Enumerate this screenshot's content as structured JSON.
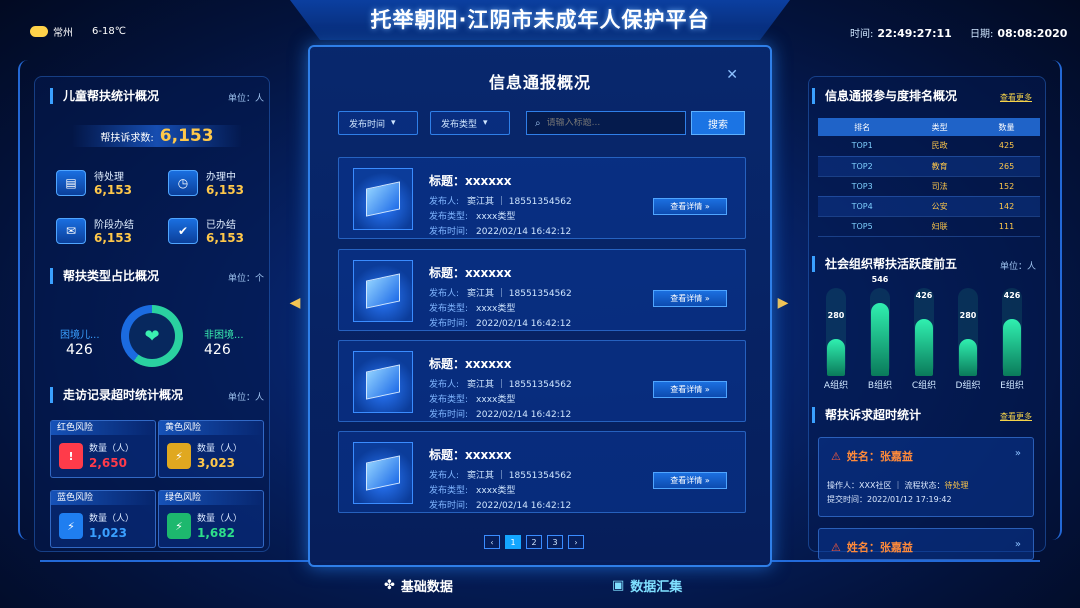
{
  "header": {
    "title": "托举朝阳·江阴市未成年人保护平台",
    "weather_city": "常州",
    "weather_temp": "6-18℃",
    "time_label": "时间:",
    "time_value": "22:49:27:11",
    "date_label": "日期:",
    "date_value": "08:08:2020"
  },
  "left": {
    "child_help": {
      "title": "儿童帮扶统计概况",
      "unit": "单位：人",
      "banner_label": "帮扶诉求数:",
      "banner_value": "6,153",
      "stats": [
        {
          "label": "待处理",
          "value": "6,153"
        },
        {
          "label": "办理中",
          "value": "6,153"
        },
        {
          "label": "阶段办结",
          "value": "6,153"
        },
        {
          "label": "已办结",
          "value": "6,153"
        }
      ]
    },
    "help_type": {
      "title": "帮扶类型占比概况",
      "unit": "单位：个",
      "left_label": "困境儿...",
      "left_value": "426",
      "right_label": "非困境...",
      "right_value": "426",
      "share_hardship": 0.6
    },
    "visit": {
      "title": "走访记录超时统计概况",
      "unit": "单位：人",
      "cards": [
        {
          "title": "红色风险",
          "count_label": "数量（人）",
          "value": "2,650",
          "color": "#ff3b4a"
        },
        {
          "title": "黄色风险",
          "count_label": "数量（人）",
          "value": "3,023",
          "color": "#ffc84a"
        },
        {
          "title": "蓝色风险",
          "count_label": "数量（人）",
          "value": "1,023",
          "color": "#3aa0ff"
        },
        {
          "title": "绿色风险",
          "count_label": "数量（人）",
          "value": "1,682",
          "color": "#2ee08a"
        }
      ]
    }
  },
  "modal": {
    "title": "信息通报概况",
    "filter_time": "发布时间",
    "filter_type": "发布类型",
    "search_placeholder": "请输入标题...",
    "search_button": "搜索",
    "items": [
      {
        "title": "标题：xxxxxx",
        "publisher_key": "发布人:",
        "publisher": "窦江其 ｜ 18551354562",
        "type_key": "发布类型:",
        "type": "xxxx类型",
        "time_key": "发布时间:",
        "time": "2022/02/14  16:42:12",
        "button": "查看详情 »"
      },
      {
        "title": "标题：xxxxxx",
        "publisher_key": "发布人:",
        "publisher": "窦江其 ｜ 18551354562",
        "type_key": "发布类型:",
        "type": "xxxx类型",
        "time_key": "发布时间:",
        "time": "2022/02/14  16:42:12",
        "button": "查看详情 »"
      },
      {
        "title": "标题：xxxxxx",
        "publisher_key": "发布人:",
        "publisher": "窦江其 ｜ 18551354562",
        "type_key": "发布类型:",
        "type": "xxxx类型",
        "time_key": "发布时间:",
        "time": "2022/02/14  16:42:12",
        "button": "查看详情 »"
      },
      {
        "title": "标题：xxxxxx",
        "publisher_key": "发布人:",
        "publisher": "窦江其 ｜ 18551354562",
        "type_key": "发布类型:",
        "type": "xxxx类型",
        "time_key": "发布时间:",
        "time": "2022/02/14  16:42:12",
        "button": "查看详情 »"
      }
    ],
    "pages": [
      "‹",
      "1",
      "2",
      "3",
      "›"
    ],
    "active_page": "1"
  },
  "right": {
    "ranking": {
      "title": "信息通报参与度排名概况",
      "more": "查看更多",
      "headers": [
        "排名",
        "类型",
        "数量"
      ],
      "rows": [
        [
          "TOP1",
          "民政",
          "425"
        ],
        [
          "TOP2",
          "教育",
          "265"
        ],
        [
          "TOP3",
          "司法",
          "152"
        ],
        [
          "TOP4",
          "公安",
          "142"
        ],
        [
          "TOP5",
          "妇联",
          "111"
        ]
      ]
    },
    "social": {
      "title": "社会组织帮扶活跃度前五",
      "unit": "单位：人",
      "max": 600,
      "bars": [
        {
          "label": "A组织",
          "value": 280
        },
        {
          "label": "B组织",
          "value": 546
        },
        {
          "label": "C组织",
          "value": 426
        },
        {
          "label": "D组织",
          "value": 280
        },
        {
          "label": "E组织",
          "value": 426
        }
      ]
    },
    "timeout": {
      "title": "帮扶诉求超时统计",
      "more": "查看更多",
      "items": [
        {
          "name": "姓名：张嘉益",
          "op": "操作人：XXX社区 ｜ 流程状态：",
          "status": "待处理",
          "time": "提交时间：2022/01/12  17:19:42"
        },
        {
          "name": "姓名：张嘉益"
        }
      ]
    }
  },
  "footer": {
    "tab1": "基础数据",
    "tab2": "数据汇集"
  }
}
